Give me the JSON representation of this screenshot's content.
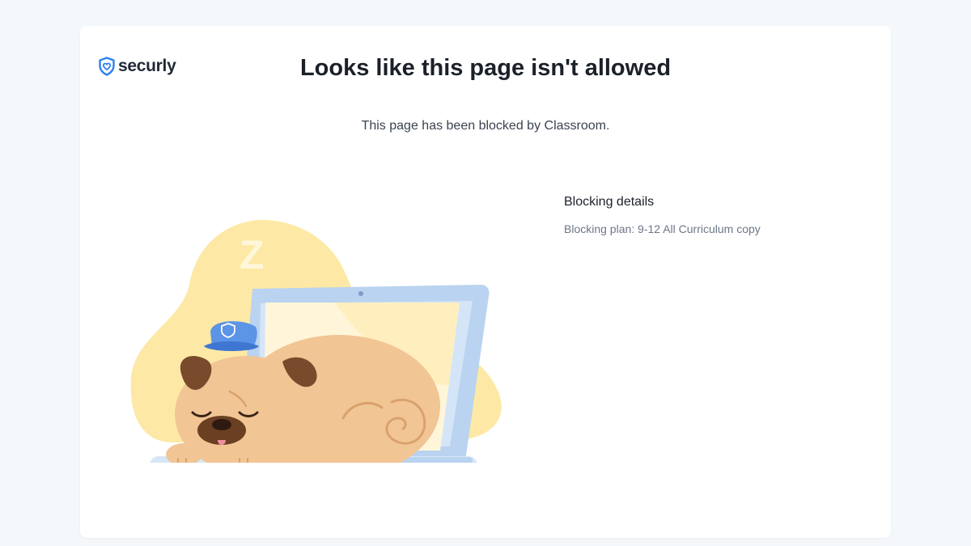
{
  "brand": {
    "name": "securly",
    "icon": "shield-heart-icon",
    "color": "#2f80ed"
  },
  "page": {
    "title": "Looks like this page isn't allowed",
    "subtitle": "This page has been blocked by Classroom."
  },
  "details": {
    "heading": "Blocking details",
    "plan": "Blocking plan: 9-12 All Curriculum copy"
  },
  "illustration": {
    "name": "sleeping-pug-on-laptop",
    "sleep_letter": "Z"
  },
  "colors": {
    "background": "#f5f8fb",
    "card": "#ffffff",
    "blob": "#fde9a5",
    "laptop": "#b9d3f0",
    "pug": "#f2c594"
  }
}
